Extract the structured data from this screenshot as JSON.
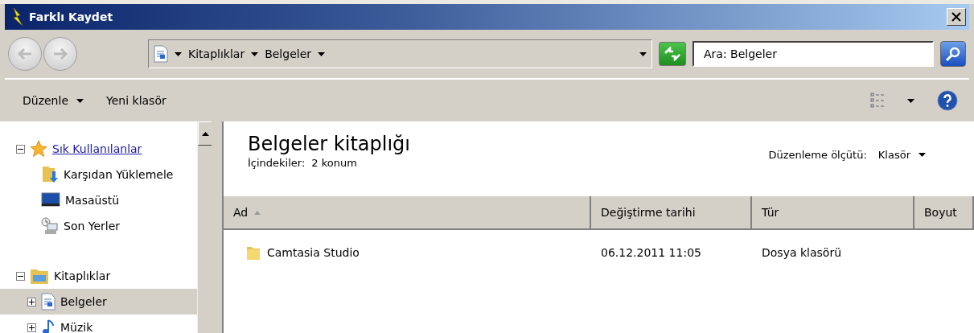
{
  "window": {
    "title": "Farklı Kaydet"
  },
  "address_bar": {
    "breadcrumbs": [
      "Kitaplıklar",
      "Belgeler"
    ]
  },
  "search": {
    "placeholder": "Ara: Belgeler"
  },
  "toolbar": {
    "buttons": [
      {
        "label": "Düzenle",
        "kind": "menu"
      },
      {
        "label": "Yeni klasör",
        "kind": "plain"
      }
    ]
  },
  "navigation": [
    {
      "label": "Sık Kullanılanlar",
      "kind": "favorites",
      "expanded": true,
      "hovered": true,
      "selected": false,
      "children": [
        {
          "label": "Karşıdan Yüklemele",
          "kind": "downloads",
          "selected": false
        },
        {
          "label": "Masaüstü",
          "kind": "desktop",
          "selected": false
        },
        {
          "label": "Son Yerler",
          "kind": "recent",
          "selected": false
        }
      ]
    },
    {
      "label": "Kitaplıklar",
      "kind": "libraries",
      "expanded": true,
      "hovered": false,
      "selected": false,
      "children": [
        {
          "label": "Belgeler",
          "kind": "documents",
          "expanded": false,
          "selected": true
        },
        {
          "label": "Müzik",
          "kind": "music",
          "expanded": false,
          "selected": false
        }
      ]
    }
  ],
  "library": {
    "title": "Belgeler kitaplığı",
    "includes_label": "İçindekiler:",
    "includes_value": "2 konum",
    "arrange_label": "Düzenleme ölçütü:",
    "arrange_value": "Klasör"
  },
  "table": {
    "columns": [
      {
        "label": "Ad",
        "sorted": true
      },
      {
        "label": "Değiştirme tarihi",
        "sorted": false
      },
      {
        "label": "Tür",
        "sorted": false
      },
      {
        "label": "Boyut",
        "sorted": false
      }
    ],
    "rows": [
      {
        "cells": [
          "Camtasia Studio",
          "06.12.2011 11:05",
          "Dosya klasörü"
        ]
      }
    ]
  }
}
